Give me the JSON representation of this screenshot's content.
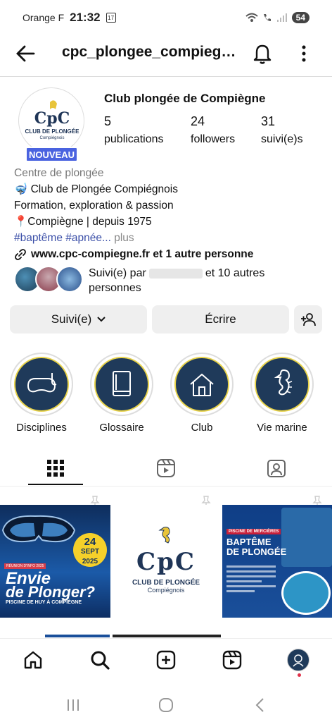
{
  "status_bar": {
    "carrier": "Orange F",
    "time": "21:32",
    "notification": "17",
    "battery": "54"
  },
  "header": {
    "username": "cpc_plongee_compiegne"
  },
  "profile": {
    "display_name": "Club plongée de Compiègne",
    "new_badge": "NOUVEAU",
    "avatar_text": "CpC",
    "avatar_subtitle": "CLUB DE PLONGÉE",
    "avatar_city": "Compiégnois",
    "stats": [
      {
        "value": "5",
        "label": "publications"
      },
      {
        "value": "24",
        "label": "followers"
      },
      {
        "value": "31",
        "label": "suivi(e)s"
      }
    ]
  },
  "bio": {
    "category": "Centre de plongée",
    "line1": "🤿 Club de Plongée Compiégnois",
    "line2": "Formation, exploration & passion",
    "line3": "📍Compiègne | depuis 1975",
    "tags": "#baptême #apnée...",
    "more": " plus",
    "link": "www.cpc-compiegne.fr et 1 autre personne"
  },
  "followed_by": {
    "prefix": "Suivi(e) par",
    "suffix": "et 10 autres personnes"
  },
  "actions": {
    "follow_label": "Suivi(e)",
    "message_label": "Écrire"
  },
  "highlights": [
    {
      "label": "Disciplines",
      "icon": "dive-mask-icon"
    },
    {
      "label": "Glossaire",
      "icon": "book-icon"
    },
    {
      "label": "Club",
      "icon": "house-icon"
    },
    {
      "label": "Vie marine",
      "icon": "seahorse-icon"
    }
  ],
  "posts": {
    "post1": {
      "date_day": "24",
      "date_month": "SEPT",
      "date_year": "2025",
      "badge": "RÉUNION D'INFO 2025",
      "line1": "Envie",
      "line2": "de Plonger?",
      "place": "PISCINE DE HUY À COMPIÈGNE"
    },
    "post2": {
      "logo": "CpC",
      "title": "CLUB DE PLONGÉE",
      "city": "Compiégnois"
    },
    "post3": {
      "badge": "PISCINE DE MERCIÈRES",
      "line1": "BAPTÊME",
      "line2": "DE PLONGÉE"
    }
  },
  "colors": {
    "accent": "#4a63e0",
    "highlight_disc": "#1f3a5a",
    "highlight_ring": "#e8d34a",
    "link": "#3b4fa8"
  }
}
